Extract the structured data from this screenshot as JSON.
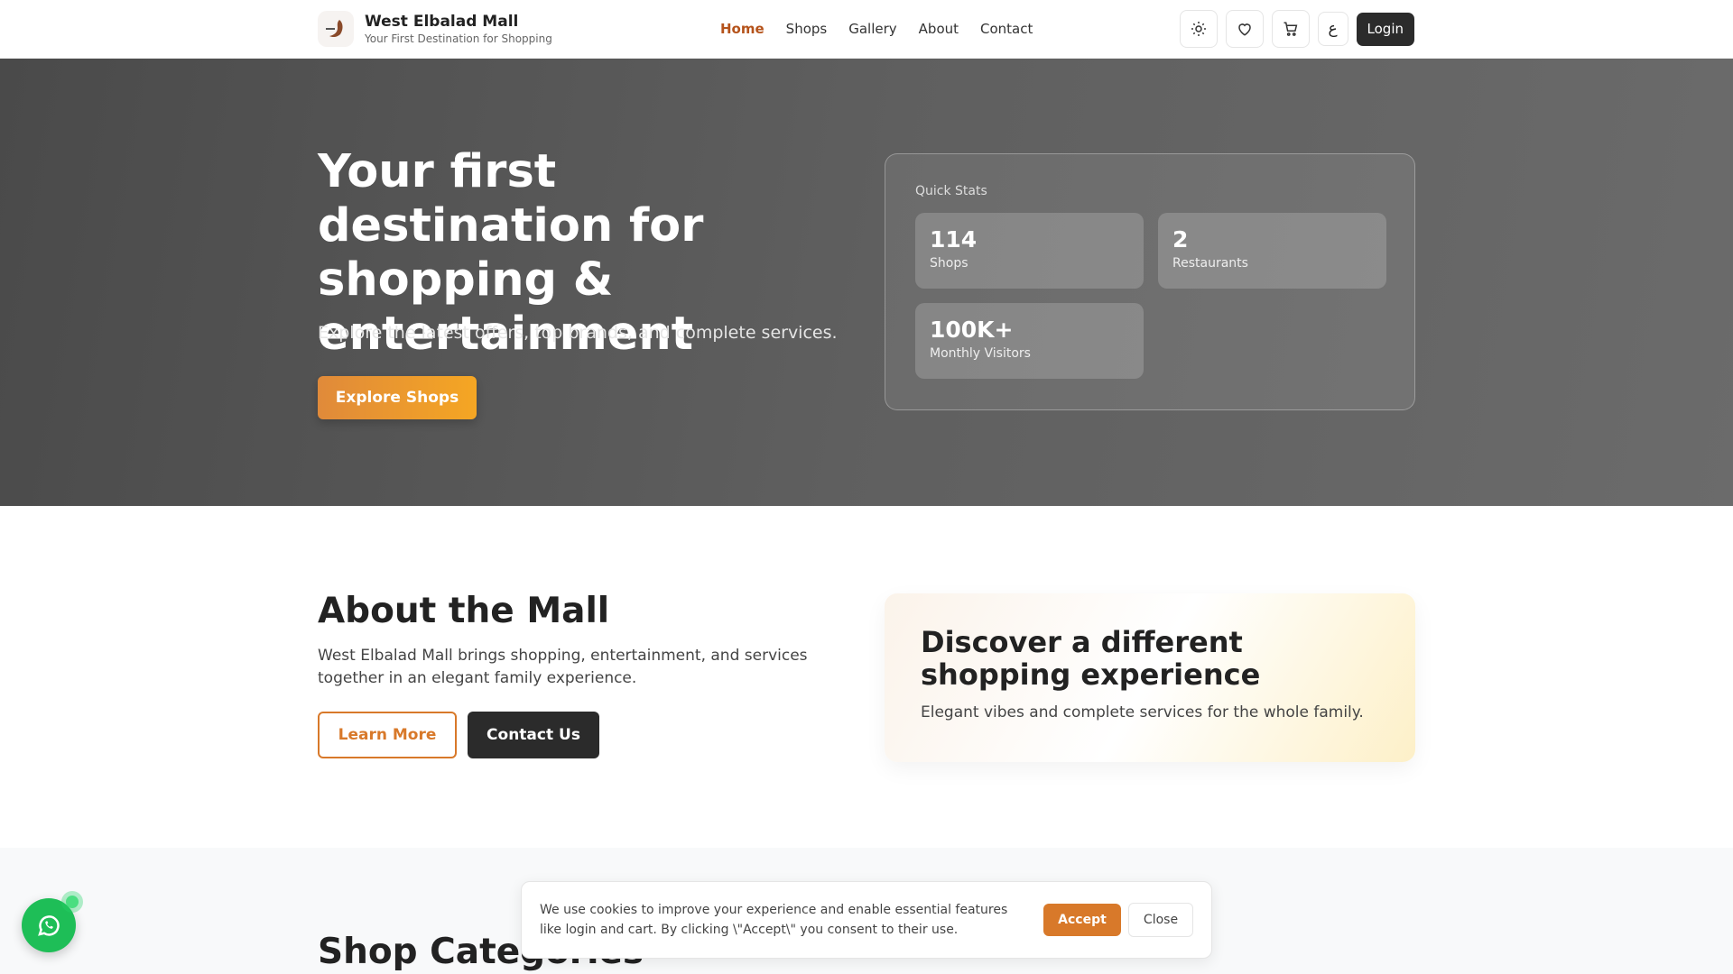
{
  "header": {
    "brand_title": "West Elbalad Mall",
    "brand_subtitle": "Your First Destination for Shopping",
    "nav": [
      "Home",
      "Shops",
      "Gallery",
      "About",
      "Contact"
    ],
    "lang_label": "ع",
    "login_label": "Login"
  },
  "hero": {
    "title": "Your first destination for shopping & entertainment",
    "subtitle": "Explore the latest offers, top brands, and complete services.",
    "cta_label": "Explore Shops",
    "stats_label": "Quick Stats",
    "stats": [
      {
        "value": "114",
        "label": "Shops"
      },
      {
        "value": "2",
        "label": "Restaurants"
      },
      {
        "value": "100K+",
        "label": "Monthly Visitors"
      }
    ]
  },
  "about": {
    "title": "About the Mall",
    "text": "West Elbalad Mall brings shopping, entertainment, and services together in an elegant family experience.",
    "learn_label": "Learn More",
    "contact_label": "Contact Us",
    "card_title": "Discover a different shopping experience",
    "card_text": "Elegant vibes and complete services for the whole family."
  },
  "categories": {
    "title": "Shop Categories"
  },
  "cookie": {
    "text": "We use cookies to improve your experience and enable essential features like login and cart. By clicking \\\"Accept\\\" you consent to their use.",
    "accept_label": "Accept",
    "close_label": "Close"
  },
  "colors": {
    "accent": "#d8792a",
    "active_nav": "#b5531b",
    "dark": "#2b2b2b",
    "whatsapp": "#1ebe57"
  }
}
